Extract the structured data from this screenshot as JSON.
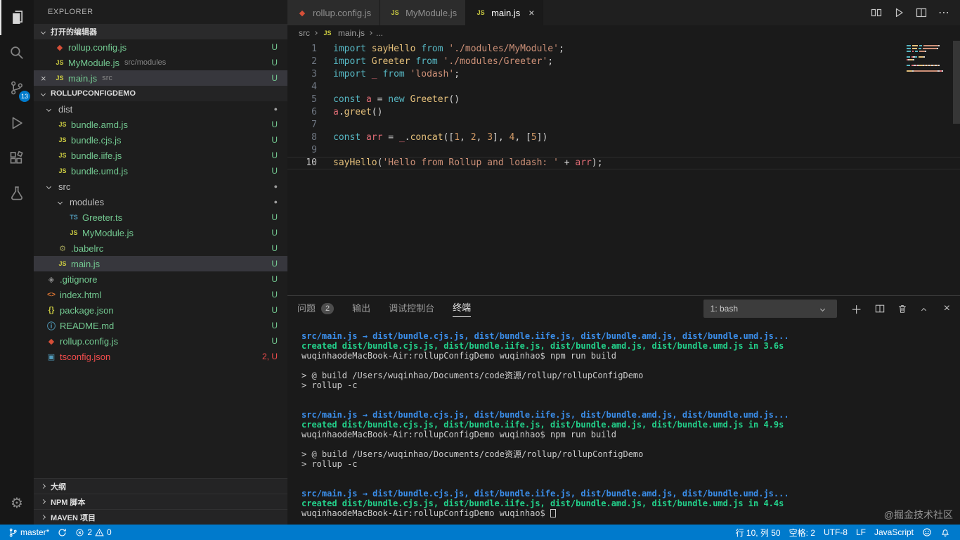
{
  "activity_bar": {
    "scm_badge": "13"
  },
  "sidebar": {
    "title": "EXPLORER",
    "open_editors_header": "打开的编辑器",
    "open_editors": [
      {
        "glyph": "◆",
        "label": "rollup.config.js",
        "detail": "",
        "badge": "U"
      },
      {
        "glyph": "JS",
        "label": "MyModule.js",
        "detail": "src/modules",
        "badge": "U"
      },
      {
        "glyph": "JS",
        "label": "main.js",
        "detail": "src",
        "badge": "U"
      }
    ],
    "project_header": "ROLLUPCONFIGDEMO",
    "tree": [
      {
        "label": "dist",
        "badge": "●"
      },
      {
        "glyph": "JS",
        "label": "bundle.amd.js",
        "badge": "U"
      },
      {
        "glyph": "JS",
        "label": "bundle.cjs.js",
        "badge": "U"
      },
      {
        "glyph": "JS",
        "label": "bundle.iife.js",
        "badge": "U"
      },
      {
        "glyph": "JS",
        "label": "bundle.umd.js",
        "badge": "U"
      },
      {
        "label": "src",
        "badge": "●"
      },
      {
        "label": "modules",
        "badge": "●"
      },
      {
        "glyph": "TS",
        "label": "Greeter.ts",
        "badge": "U"
      },
      {
        "glyph": "JS",
        "label": "MyModule.js",
        "badge": "U"
      },
      {
        "glyph": "⚙",
        "label": ".babelrc",
        "badge": "U"
      },
      {
        "glyph": "JS",
        "label": "main.js",
        "badge": "U"
      },
      {
        "glyph": "◈",
        "label": ".gitignore",
        "badge": "U"
      },
      {
        "glyph": "<>",
        "label": "index.html",
        "badge": "U"
      },
      {
        "glyph": "{}",
        "label": "package.json",
        "badge": "U"
      },
      {
        "glyph": "ⓘ",
        "label": "README.md",
        "badge": "U"
      },
      {
        "glyph": "◆",
        "label": "rollup.config.js",
        "badge": "U"
      },
      {
        "glyph": "▣",
        "label": "tsconfig.json",
        "badge": "2, U"
      }
    ],
    "bottom_sections": [
      {
        "label": "大纲"
      },
      {
        "label": "NPM 脚本"
      },
      {
        "label": "MAVEN 项目"
      }
    ]
  },
  "tabs": [
    {
      "glyph": "◆",
      "label": "rollup.config.js"
    },
    {
      "glyph": "JS",
      "label": "MyModule.js"
    },
    {
      "glyph": "JS",
      "label": "main.js"
    }
  ],
  "breadcrumb": {
    "root": "src",
    "file_glyph": "JS",
    "file": "main.js",
    "more": "..."
  },
  "editor": {
    "lines": [
      {
        "num": "1",
        "tokens": [
          {
            "t": "import",
            "c": "kw"
          },
          {
            "t": " ",
            "c": "pl"
          },
          {
            "t": "sayHello",
            "c": "fn"
          },
          {
            "t": " ",
            "c": "pl"
          },
          {
            "t": "from",
            "c": "kw"
          },
          {
            "t": " ",
            "c": "pl"
          },
          {
            "t": "'./modules/MyModule'",
            "c": "str"
          },
          {
            "t": ";",
            "c": "pl"
          }
        ]
      },
      {
        "num": "2",
        "tokens": [
          {
            "t": "import",
            "c": "kw"
          },
          {
            "t": " ",
            "c": "pl"
          },
          {
            "t": "Greeter",
            "c": "cls"
          },
          {
            "t": " ",
            "c": "pl"
          },
          {
            "t": "from",
            "c": "kw"
          },
          {
            "t": " ",
            "c": "pl"
          },
          {
            "t": "'./modules/Greeter'",
            "c": "str"
          },
          {
            "t": ";",
            "c": "pl"
          }
        ]
      },
      {
        "num": "3",
        "tokens": [
          {
            "t": "import",
            "c": "kw"
          },
          {
            "t": " ",
            "c": "pl"
          },
          {
            "t": "_",
            "c": "var"
          },
          {
            "t": " ",
            "c": "pl"
          },
          {
            "t": "from",
            "c": "kw"
          },
          {
            "t": " ",
            "c": "pl"
          },
          {
            "t": "'lodash'",
            "c": "str"
          },
          {
            "t": ";",
            "c": "pl"
          }
        ]
      },
      {
        "num": "4",
        "tokens": []
      },
      {
        "num": "5",
        "tokens": [
          {
            "t": "const",
            "c": "kw"
          },
          {
            "t": " ",
            "c": "pl"
          },
          {
            "t": "a",
            "c": "var"
          },
          {
            "t": " = ",
            "c": "op"
          },
          {
            "t": "new",
            "c": "kw"
          },
          {
            "t": " ",
            "c": "pl"
          },
          {
            "t": "Greeter",
            "c": "cls"
          },
          {
            "t": "()",
            "c": "pl"
          }
        ]
      },
      {
        "num": "6",
        "tokens": [
          {
            "t": "a",
            "c": "var"
          },
          {
            "t": ".",
            "c": "pl"
          },
          {
            "t": "greet",
            "c": "fn"
          },
          {
            "t": "()",
            "c": "pl"
          }
        ]
      },
      {
        "num": "7",
        "tokens": []
      },
      {
        "num": "8",
        "tokens": [
          {
            "t": "const",
            "c": "kw"
          },
          {
            "t": " ",
            "c": "pl"
          },
          {
            "t": "arr",
            "c": "var"
          },
          {
            "t": " = ",
            "c": "op"
          },
          {
            "t": "_",
            "c": "var"
          },
          {
            "t": ".",
            "c": "pl"
          },
          {
            "t": "concat",
            "c": "fn"
          },
          {
            "t": "([",
            "c": "pl"
          },
          {
            "t": "1",
            "c": "num"
          },
          {
            "t": ", ",
            "c": "pl"
          },
          {
            "t": "2",
            "c": "num"
          },
          {
            "t": ", ",
            "c": "pl"
          },
          {
            "t": "3",
            "c": "num"
          },
          {
            "t": "], ",
            "c": "pl"
          },
          {
            "t": "4",
            "c": "num"
          },
          {
            "t": ", [",
            "c": "pl"
          },
          {
            "t": "5",
            "c": "num"
          },
          {
            "t": "])",
            "c": "pl"
          }
        ]
      },
      {
        "num": "9",
        "tokens": []
      },
      {
        "num": "10",
        "tokens": [
          {
            "t": "sayHello",
            "c": "fn"
          },
          {
            "t": "(",
            "c": "pl"
          },
          {
            "t": "'Hello from Rollup and lodash: '",
            "c": "str"
          },
          {
            "t": " + ",
            "c": "op"
          },
          {
            "t": "arr",
            "c": "var"
          },
          {
            "t": ");",
            "c": "pl"
          }
        ]
      }
    ]
  },
  "panel": {
    "tabs": [
      {
        "label": "问题",
        "badge": "2"
      },
      {
        "label": "输出"
      },
      {
        "label": "调试控制台"
      },
      {
        "label": "终端"
      }
    ],
    "shell_selector": "1: bash",
    "terminal": [
      {
        "text": "src/main.js → dist/bundle.cjs.js, dist/bundle.iife.js, dist/bundle.amd.js, dist/bundle.umd.js...",
        "color": "cyan"
      },
      {
        "text": "created dist/bundle.cjs.js, dist/bundle.iife.js, dist/bundle.amd.js, dist/bundle.umd.js in 3.6s",
        "color": "green"
      },
      {
        "text": "wuqinhaodeMacBook-Air:rollupConfigDemo wuqinhao$ npm run build",
        "color": "fg"
      },
      {
        "text": "",
        "color": "fg"
      },
      {
        "text": "> @ build /Users/wuqinhao/Documents/code资源/rollup/rollupConfigDemo",
        "color": "fg"
      },
      {
        "text": "> rollup -c",
        "color": "fg"
      },
      {
        "text": "",
        "color": "fg"
      },
      {
        "text": "",
        "color": "fg"
      },
      {
        "text": "src/main.js → dist/bundle.cjs.js, dist/bundle.iife.js, dist/bundle.amd.js, dist/bundle.umd.js...",
        "color": "cyan"
      },
      {
        "text": "created dist/bundle.cjs.js, dist/bundle.iife.js, dist/bundle.amd.js, dist/bundle.umd.js in 4.9s",
        "color": "green"
      },
      {
        "text": "wuqinhaodeMacBook-Air:rollupConfigDemo wuqinhao$ npm run build",
        "color": "fg"
      },
      {
        "text": "",
        "color": "fg"
      },
      {
        "text": "> @ build /Users/wuqinhao/Documents/code资源/rollup/rollupConfigDemo",
        "color": "fg"
      },
      {
        "text": "> rollup -c",
        "color": "fg"
      },
      {
        "text": "",
        "color": "fg"
      },
      {
        "text": "",
        "color": "fg"
      },
      {
        "text": "src/main.js → dist/bundle.cjs.js, dist/bundle.iife.js, dist/bundle.amd.js, dist/bundle.umd.js...",
        "color": "cyan"
      },
      {
        "text": "created dist/bundle.cjs.js, dist/bundle.iife.js, dist/bundle.amd.js, dist/bundle.umd.js in 4.4s",
        "color": "green"
      },
      {
        "text": "wuqinhaodeMacBook-Air:rollupConfigDemo wuqinhao$ ",
        "color": "fg",
        "cursor": true
      }
    ]
  },
  "status_bar": {
    "branch": "master*",
    "errors": "2",
    "warnings": "0",
    "cursor_position": "行 10, 列 50",
    "indentation": "空格: 2",
    "encoding": "UTF-8",
    "eol": "LF",
    "language": "JavaScript"
  },
  "watermark": "@掘金技术社区"
}
